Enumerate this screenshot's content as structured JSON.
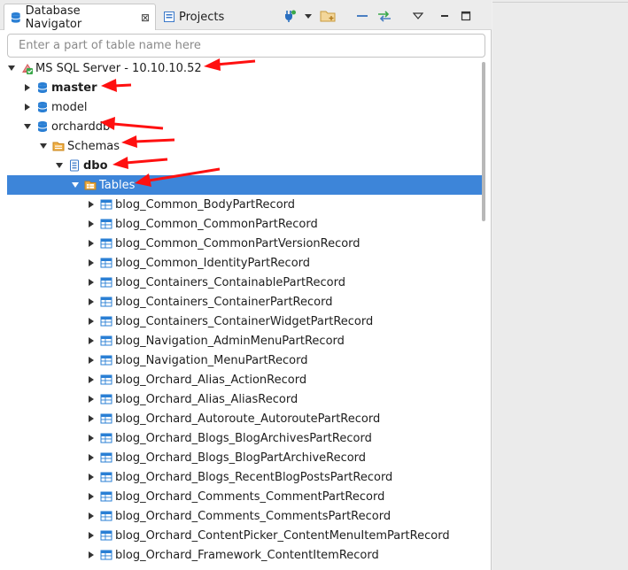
{
  "tabs": {
    "navigator_label": "Database Navigator",
    "navigator_close": "⊠",
    "projects_label": "Projects"
  },
  "search": {
    "placeholder": "Enter a part of table name here"
  },
  "tree": {
    "server": "MS SQL Server - 10.10.10.52",
    "db_master": "master",
    "db_model": "model",
    "db_orcharddb": "orcharddb",
    "schemas": "Schemas",
    "schema_dbo": "dbo",
    "tables": "Tables",
    "table_names": [
      "blog_Common_BodyPartRecord",
      "blog_Common_CommonPartRecord",
      "blog_Common_CommonPartVersionRecord",
      "blog_Common_IdentityPartRecord",
      "blog_Containers_ContainablePartRecord",
      "blog_Containers_ContainerPartRecord",
      "blog_Containers_ContainerWidgetPartRecord",
      "blog_Navigation_AdminMenuPartRecord",
      "blog_Navigation_MenuPartRecord",
      "blog_Orchard_Alias_ActionRecord",
      "blog_Orchard_Alias_AliasRecord",
      "blog_Orchard_Autoroute_AutoroutePartRecord",
      "blog_Orchard_Blogs_BlogArchivesPartRecord",
      "blog_Orchard_Blogs_BlogPartArchiveRecord",
      "blog_Orchard_Blogs_RecentBlogPostsPartRecord",
      "blog_Orchard_Comments_CommentPartRecord",
      "blog_Orchard_Comments_CommentsPartRecord",
      "blog_Orchard_ContentPicker_ContentMenuItemPartRecord",
      "blog_Orchard_Framework_ContentItemRecord"
    ]
  },
  "colors": {
    "selection": "#3d85d9",
    "db_icon": "#2a7fd4",
    "folder_icon": "#e8a02c",
    "annotation_arrow": "#ff1010"
  }
}
